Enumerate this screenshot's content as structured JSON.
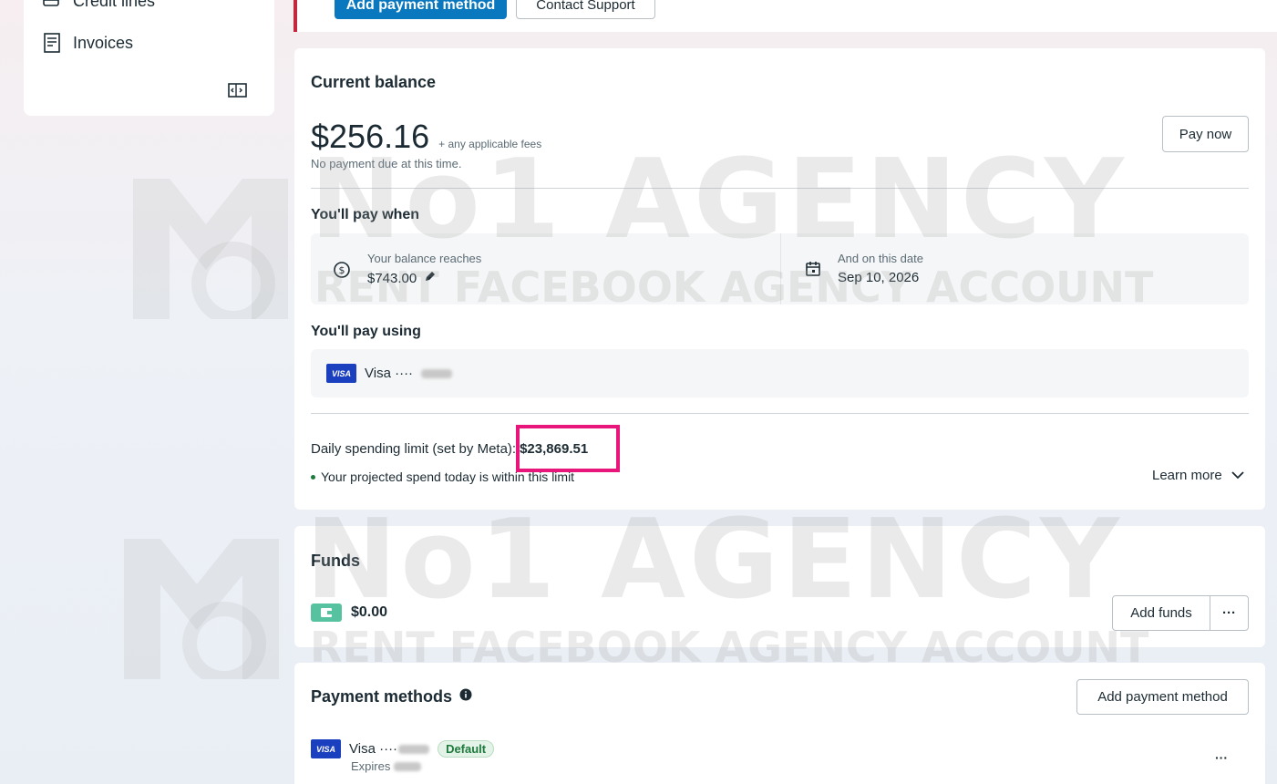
{
  "sidebar": {
    "items": [
      {
        "label": "Credit lines",
        "icon": "credit-lines-icon"
      },
      {
        "label": "Invoices",
        "icon": "invoice-icon"
      }
    ],
    "collapse_icon": "sidebar-collapse-icon"
  },
  "top": {
    "add_payment_label": "Add payment method",
    "contact_support_label": "Contact Support"
  },
  "balance": {
    "title": "Current balance",
    "amount": "$256.16",
    "fees_note": "+ any applicable fees",
    "status": "No payment due at this time.",
    "pay_now_label": "Pay now",
    "pay_when_title": "You'll pay when",
    "threshold_label": "Your balance reaches",
    "threshold_value": "$743.00",
    "date_label": "And on this date",
    "date_value": "Sep 10, 2026",
    "pay_using_title": "You'll pay using",
    "card_brand": "VISA",
    "card_label": "Visa ····",
    "limit_label": "Daily spending limit (set by Meta):",
    "limit_value": "$23,869.51",
    "projected_note": "Your projected spend today is within this limit",
    "learn_more_label": "Learn more"
  },
  "funds": {
    "title": "Funds",
    "amount": "$0.00",
    "add_funds_label": "Add funds",
    "more_label": "···"
  },
  "payment_methods": {
    "title": "Payment methods",
    "add_label": "Add payment method",
    "card_brand": "VISA",
    "card_label": "Visa ····",
    "default_badge": "Default",
    "expires_label": "Expires",
    "more_label": "···"
  },
  "watermark": {
    "title": "No1 AGENCY",
    "subtitle": "RENT FACEBOOK AGENCY ACCOUNT"
  },
  "colors": {
    "primary_button": "#0a78be",
    "highlight_box": "#e8157a",
    "top_card_accent": "#c5283d",
    "status_dot": "#1e7a3c"
  }
}
